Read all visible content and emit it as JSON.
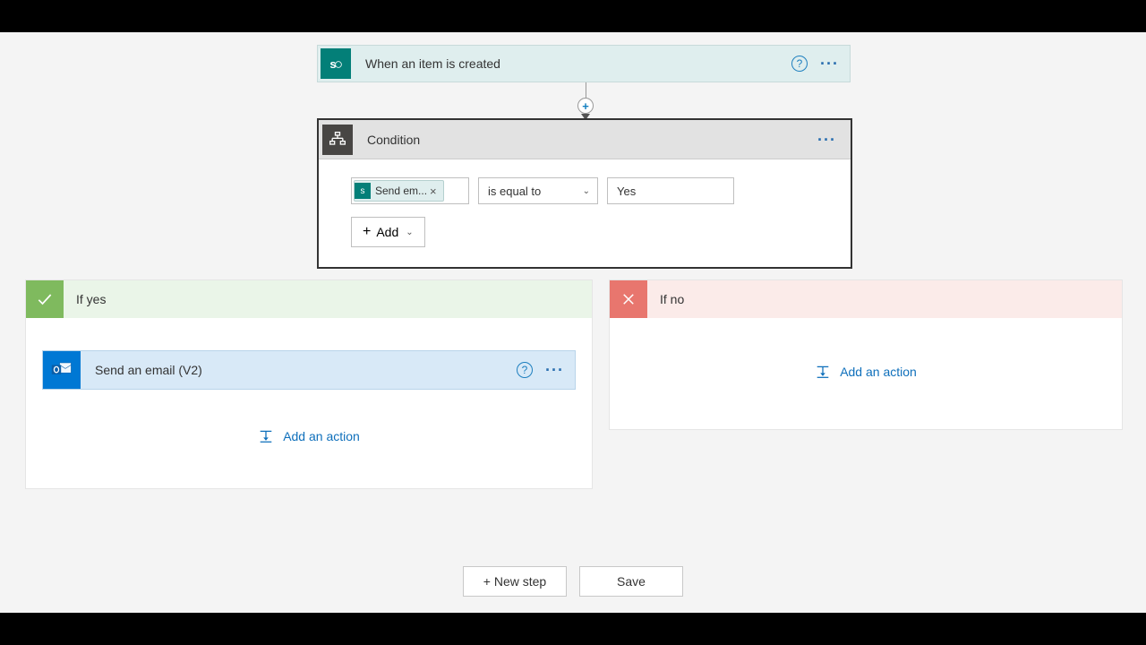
{
  "trigger": {
    "title": "When an item is created",
    "icon_letter": "s"
  },
  "condition": {
    "title": "Condition",
    "token_label": "Send em...",
    "operator": "is equal to",
    "value": "Yes",
    "add_label": "Add"
  },
  "branches": {
    "yes_label": "If yes",
    "no_label": "If no",
    "email_action_title": "Send an email (V2)",
    "add_action_label": "Add an action"
  },
  "buttons": {
    "new_step": "+ New step",
    "save": "Save"
  }
}
